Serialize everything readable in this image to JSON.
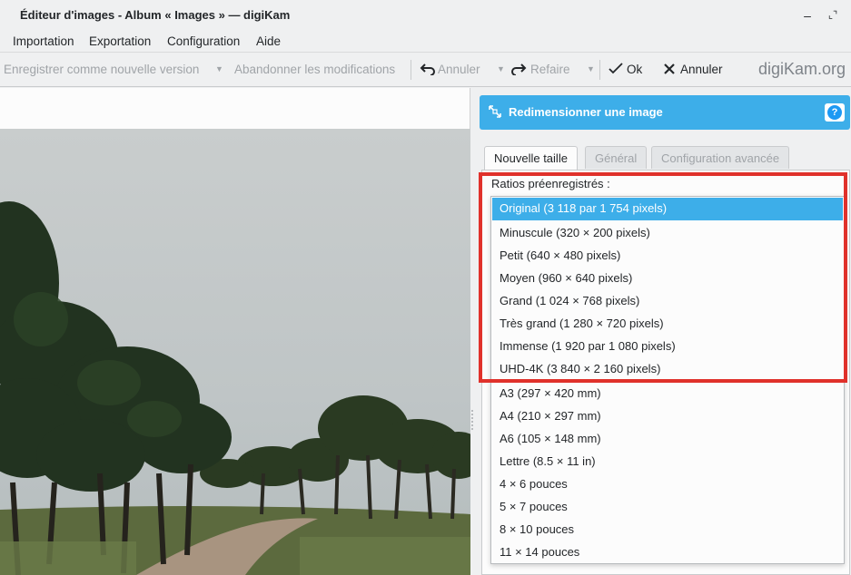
{
  "window": {
    "title": "Éditeur d'images - Album « Images » — digiKam",
    "minimize_glyph": "–",
    "restore_glyph": "⌞⌝"
  },
  "menu": {
    "items": [
      "Importation",
      "Exportation",
      "Configuration",
      "Aide"
    ]
  },
  "toolbar": {
    "save_new_version": "Enregistrer comme nouvelle version",
    "discard": "Abandonner les modifications",
    "undo": "Annuler",
    "redo": "Refaire",
    "ok": "Ok",
    "cancel": "Annuler",
    "brand": "digiKam.org"
  },
  "tool": {
    "title": "Redimensionner une image",
    "help_glyph": "?"
  },
  "tabs": [
    {
      "label": "Nouvelle taille",
      "active": true
    },
    {
      "label": "Général",
      "active": false
    },
    {
      "label": "Configuration avancée",
      "active": false
    }
  ],
  "presets": {
    "label": "Ratios préenregistrés :",
    "selected_index": 0,
    "options": [
      "Original (3 118 par 1 754 pixels)",
      "Minuscule (320 × 200 pixels)",
      "Petit (640 × 480 pixels)",
      "Moyen (960 × 640 pixels)",
      "Grand (1 024 × 768 pixels)",
      "Très grand (1 280 × 720 pixels)",
      "Immense (1 920 par 1 080 pixels)",
      "UHD-4K (3 840 × 2 160 pixels)",
      "A3 (297 × 420 mm)",
      "A4 (210 × 297 mm)",
      "A6 (105 × 148 mm)",
      "Lettre (8.5 × 11 in)",
      "4 × 6 pouces",
      "5 × 7 pouces",
      "8 × 10 pouces",
      "11 × 14 pouces"
    ]
  },
  "colors": {
    "accent": "#3daee9",
    "highlight_box": "#e0312b",
    "window_bg": "#eff0f1"
  }
}
